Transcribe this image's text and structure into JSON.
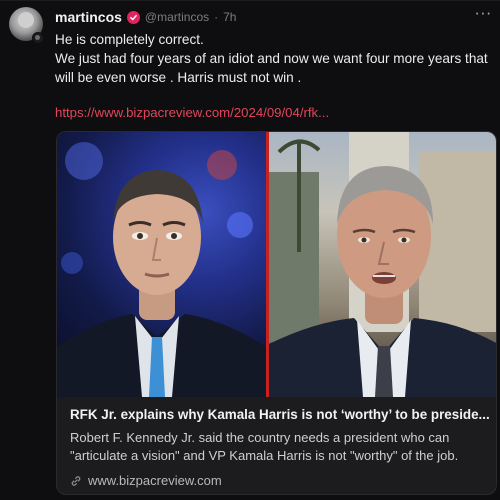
{
  "post": {
    "author": {
      "display_name": "martincos",
      "handle": "@martincos",
      "time": "7h",
      "separator": "·",
      "verified_icon": "verified-check-icon",
      "avatar_icon": "avatar-image"
    },
    "more_label": "···",
    "body_lines": [
      "He is completely correct.",
      "We just had four years of an idiot and now we want four more years that will be even worse . Harris must not win ."
    ],
    "link_text": "https://www.bizpacreview.com/2024/09/04/rfk...",
    "colors": {
      "link": "#e1465b",
      "verified": "#e0245e",
      "divider": "#c92020"
    },
    "card": {
      "title": "RFK Jr. explains why Kamala Harris is not  ‘worthy’ to be preside...",
      "description": "Robert F. Kennedy Jr. said the country needs a president who can \"articulate a vision\" and VP Kamala Harris is not \"worthy\" of the job.",
      "domain": "www.bizpacreview.com",
      "domain_icon": "link-icon",
      "image": "split-screen-news-interview-image"
    }
  }
}
